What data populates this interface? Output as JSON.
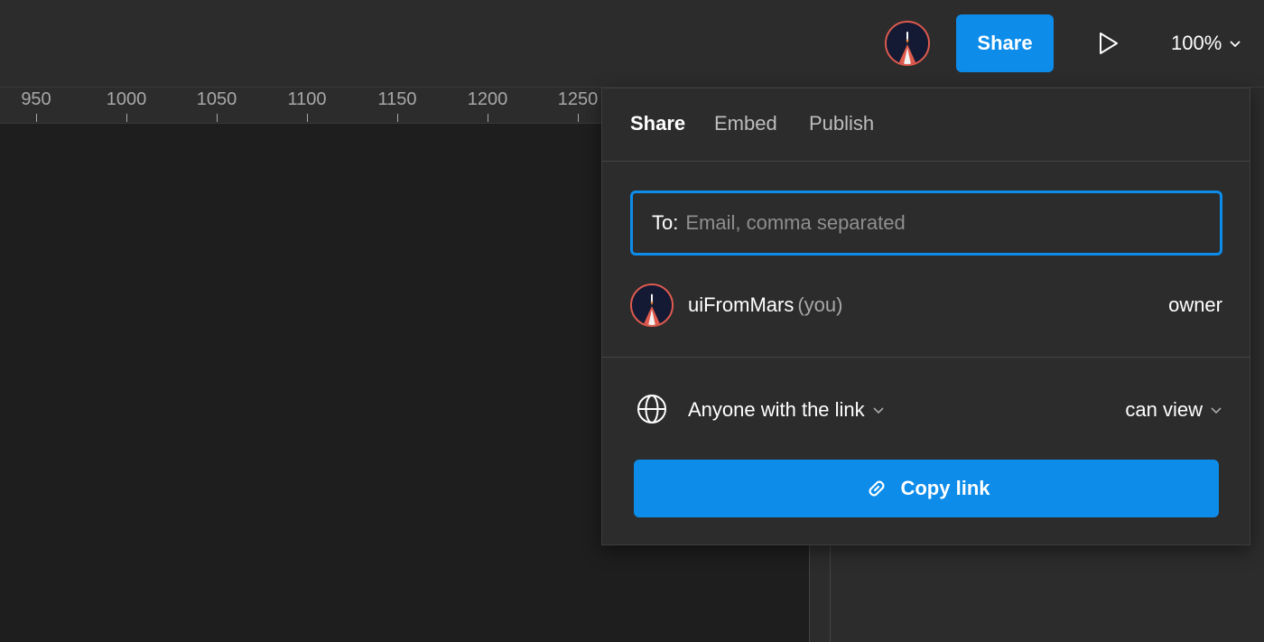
{
  "toolbar": {
    "share_label": "Share",
    "zoom_value": "100%",
    "avatar_icon": "rocket-avatar-icon",
    "play_icon": "play-icon"
  },
  "ruler": {
    "ticks": [
      "950",
      "1000",
      "1050",
      "1100",
      "1150",
      "1200",
      "1250"
    ]
  },
  "share_dialog": {
    "tabs": [
      {
        "label": "Share",
        "active": true
      },
      {
        "label": "Embed",
        "active": false
      },
      {
        "label": "Publish",
        "active": false
      }
    ],
    "to_label": "To:",
    "to_placeholder": "Email, comma separated",
    "user": {
      "name": "uiFromMars",
      "you_tag": "(you)",
      "role": "owner"
    },
    "link_access": "Anyone with the link",
    "link_permission": "can view",
    "copy_link_label": "Copy link"
  },
  "colors": {
    "accent": "#0d8ce9",
    "background": "#2c2c2c",
    "canvas": "#1e1e1e"
  }
}
